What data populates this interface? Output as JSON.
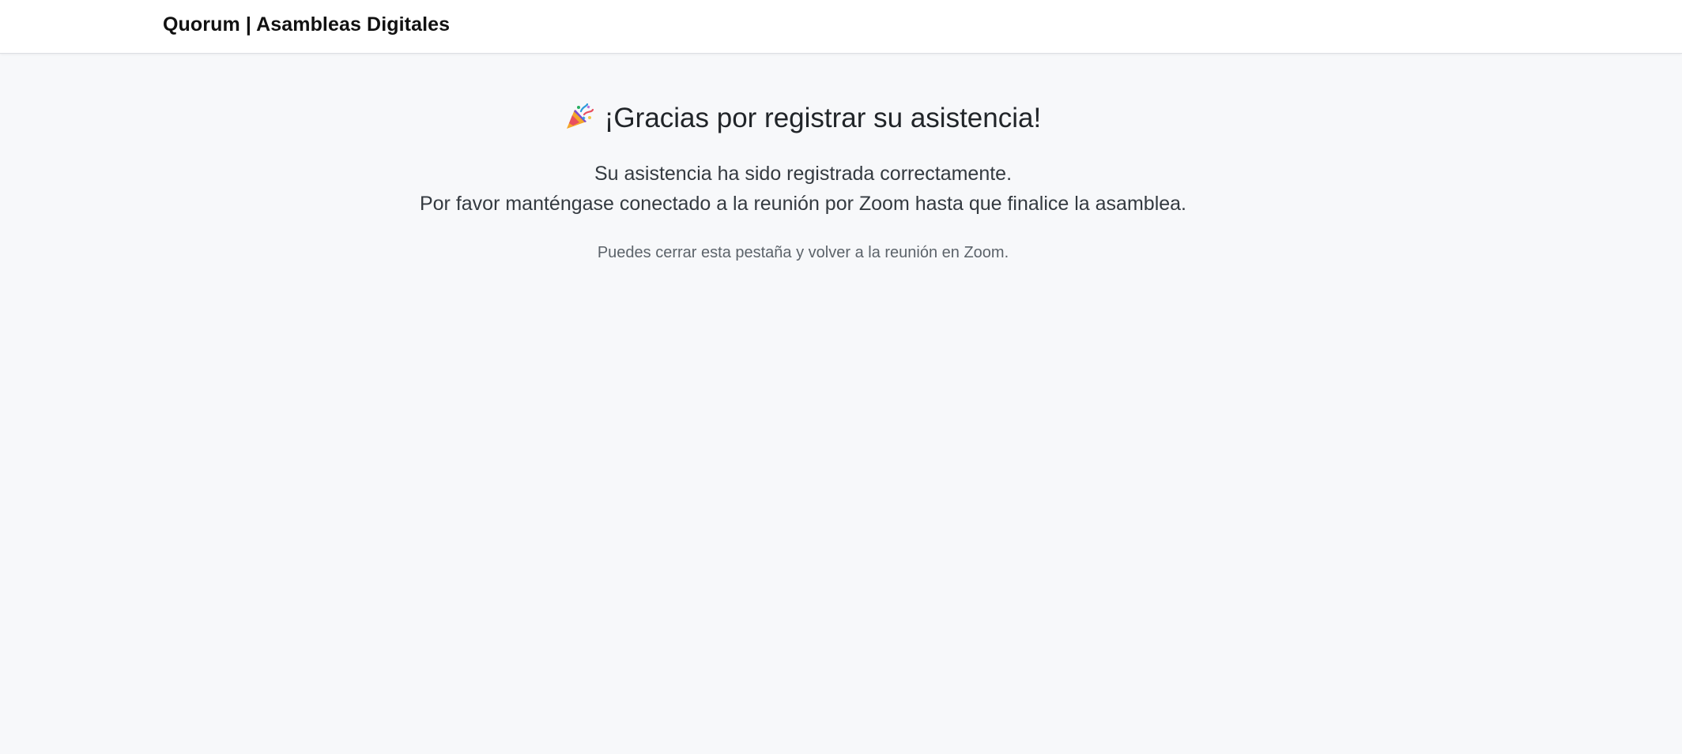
{
  "navbar": {
    "brand": "Quorum | Asambleas Digitales"
  },
  "main": {
    "icon": "party-popper-icon",
    "title": "¡Gracias por registrar su asistencia!",
    "message_line_1": "Su asistencia ha sido registrada correctamente.",
    "message_line_2": "Por favor manténgase conectado a la reunión por Zoom hasta que finalice la asamblea.",
    "note": "Puedes cerrar esta pestaña y volver a la reunión en Zoom."
  }
}
